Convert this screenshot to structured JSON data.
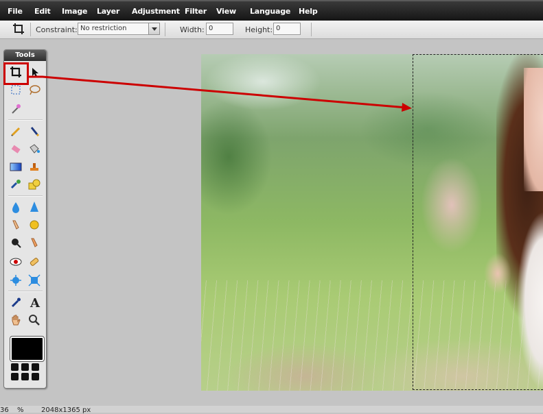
{
  "menu": {
    "items": [
      "File",
      "Edit",
      "Image",
      "Layer",
      "Adjustment",
      "Filter",
      "View",
      "Language",
      "Help"
    ]
  },
  "options_bar": {
    "constraint_label": "Constraint:",
    "constraint_value": "No restriction",
    "width_label": "Width:",
    "width_value": "0",
    "height_label": "Height:",
    "height_value": "0"
  },
  "tools_panel": {
    "title": "Tools",
    "icons": [
      "crop-icon",
      "move-icon",
      "marquee-icon",
      "lasso-icon",
      "magic-wand-icon",
      "pencil-icon",
      "brush-icon",
      "eraser-icon",
      "paint-bucket-icon",
      "gradient-icon",
      "clone-stamp-icon",
      "color-replace-icon",
      "shape-icon",
      "blur-icon",
      "sharpen-icon",
      "smudge-icon",
      "sponge-icon",
      "dodge-icon",
      "burn-icon",
      "red-eye-icon",
      "spot-heal-icon",
      "bloat-icon",
      "pinch-icon",
      "eyedropper-icon",
      "type-icon",
      "hand-icon",
      "zoom-icon"
    ]
  },
  "status": {
    "zoom": "36",
    "zoom_unit": "%",
    "dimensions": "2048x1365 px"
  },
  "colors": {
    "highlight": "#cc0000",
    "menubar": "#222222"
  }
}
